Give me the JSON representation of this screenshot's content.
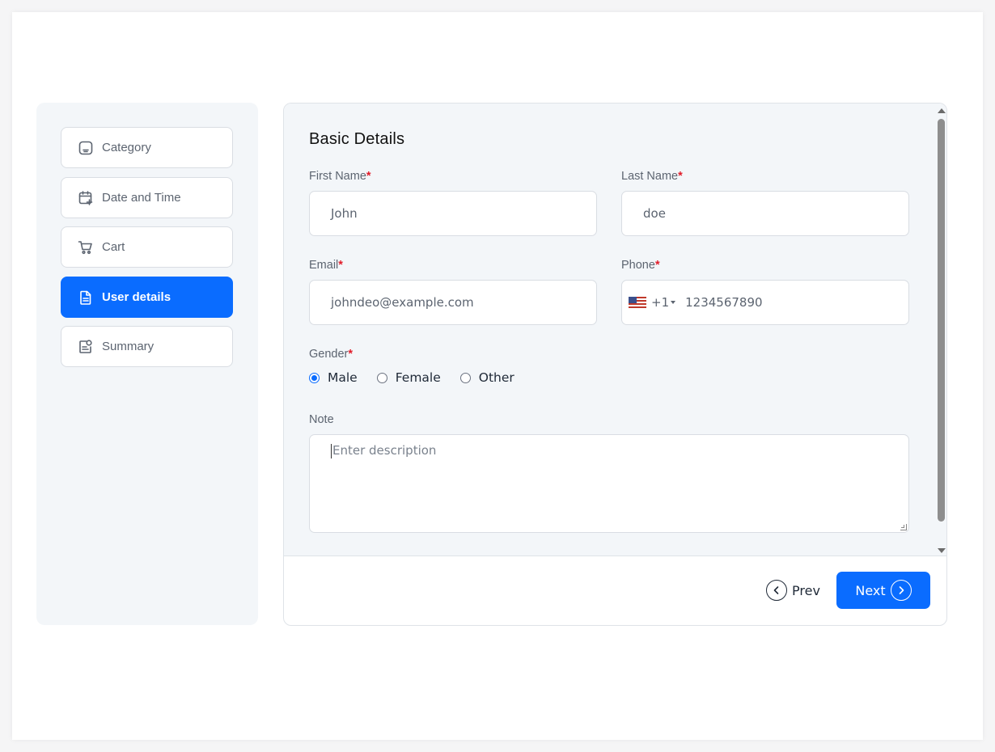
{
  "steps": [
    {
      "label": "Category",
      "icon": "category-icon"
    },
    {
      "label": "Date and Time",
      "icon": "calendar-plus-icon"
    },
    {
      "label": "Cart",
      "icon": "cart-icon"
    },
    {
      "label": "User details",
      "icon": "document-icon",
      "active": true
    },
    {
      "label": "Summary",
      "icon": "summary-icon"
    }
  ],
  "form": {
    "title": "Basic Details",
    "first_name": {
      "label": "First Name",
      "value": "John"
    },
    "last_name": {
      "label": "Last Name",
      "value": "doe"
    },
    "email": {
      "label": "Email",
      "value": "johndeo@example.com"
    },
    "phone": {
      "label": "Phone",
      "country_code": "+1",
      "value": "1234567890"
    },
    "required_mark": "*",
    "gender": {
      "label": "Gender",
      "options": [
        "Male",
        "Female",
        "Other"
      ],
      "selected": "Male"
    },
    "note": {
      "label": "Note",
      "placeholder": "Enter description"
    }
  },
  "footer": {
    "prev_label": "Prev",
    "next_label": "Next"
  },
  "colors": {
    "accent": "#0a6cff",
    "required": "#e11d2a"
  }
}
